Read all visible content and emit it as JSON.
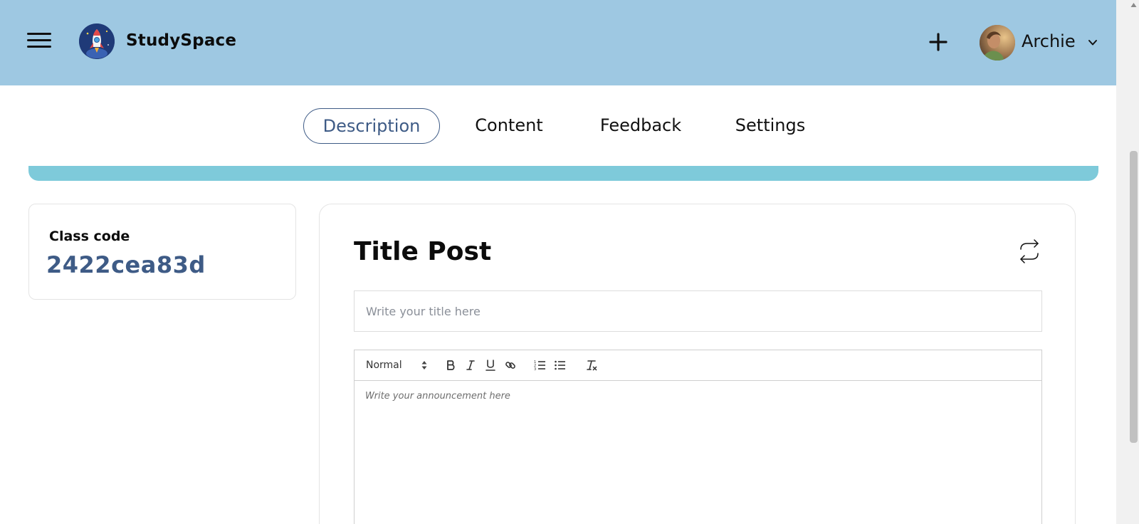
{
  "header": {
    "brand": "StudySpace",
    "username": "Archie"
  },
  "tabs": [
    {
      "label": "Description",
      "active": true
    },
    {
      "label": "Content",
      "active": false
    },
    {
      "label": "Feedback",
      "active": false
    },
    {
      "label": "Settings",
      "active": false
    }
  ],
  "class_code": {
    "label": "Class code",
    "value": "2422cea83d"
  },
  "post": {
    "title": "Title Post",
    "title_placeholder": "Write your title here",
    "format_select": "Normal",
    "body_placeholder": "Write your announcement here"
  },
  "colors": {
    "header_bg": "#9ec8e2",
    "accent": "#3e5b86",
    "banner": "#7ecada"
  },
  "icons": [
    "menu-icon",
    "rocket-logo-icon",
    "plus-icon",
    "chevron-down-icon",
    "swap-icon",
    "bold-icon",
    "italic-icon",
    "underline-icon",
    "link-icon",
    "ordered-list-icon",
    "bullet-list-icon",
    "clear-format-icon"
  ]
}
